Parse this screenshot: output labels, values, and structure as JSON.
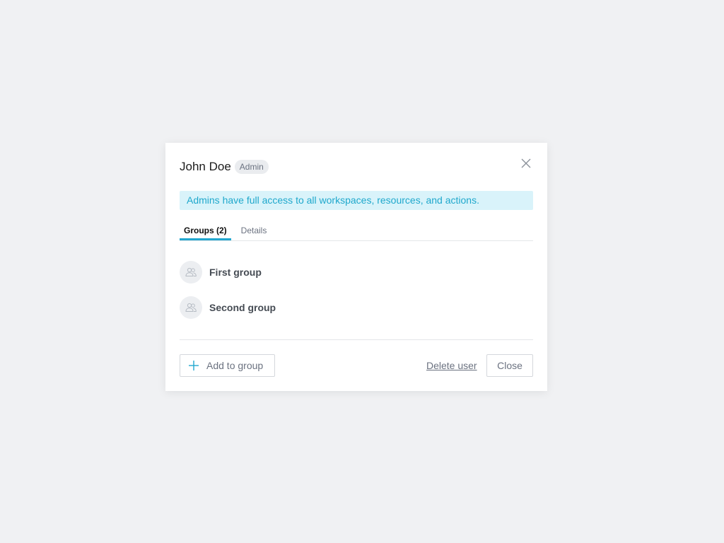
{
  "user": {
    "name": "John Doe",
    "role_badge": "Admin"
  },
  "banner": {
    "text": "Admins have full access to all workspaces, resources, and actions."
  },
  "tabs": [
    {
      "label": "Groups (2)",
      "active": true
    },
    {
      "label": "Details",
      "active": false
    }
  ],
  "groups": [
    {
      "name": "First group",
      "icon": "group-icon"
    },
    {
      "name": "Second group",
      "icon": "group-icon"
    }
  ],
  "footer": {
    "add_label": "Add to group",
    "delete_label": "Delete user",
    "close_label": "Close"
  },
  "colors": {
    "accent": "#22a7cf",
    "banner_bg": "#d9f3fa",
    "banner_text": "#1fa8cc",
    "page_bg": "#f0f1f3"
  },
  "icons": {
    "close": "close-icon",
    "add": "plus-icon",
    "group": "group-icon"
  }
}
